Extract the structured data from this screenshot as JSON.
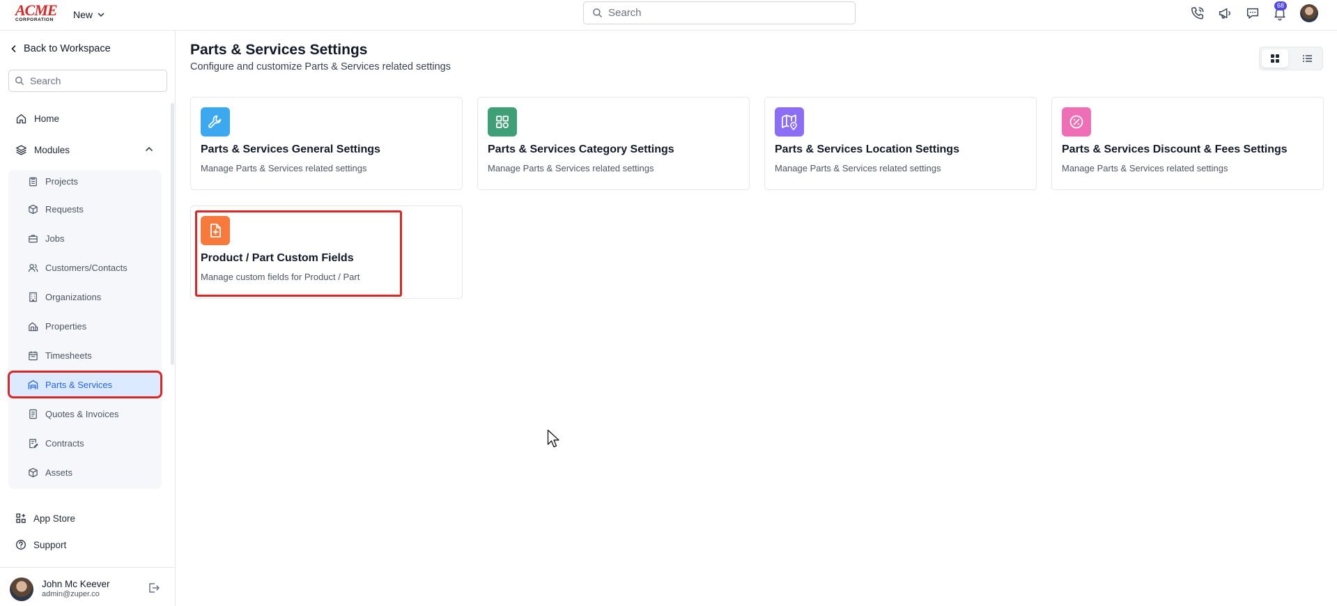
{
  "brand": {
    "logo_main": "ACME",
    "logo_sub": "CORPORATION"
  },
  "topbar": {
    "new_label": "New",
    "search_placeholder": "Search",
    "notification_count": "68",
    "icons": [
      "phone-icon",
      "megaphone-icon",
      "chat-icon",
      "bell-icon"
    ]
  },
  "sidebar": {
    "back_label": "Back to Workspace",
    "search_placeholder": "Search",
    "home_label": "Home",
    "modules_label": "Modules",
    "modules": [
      {
        "label": "Projects",
        "icon": "clipboard-icon"
      },
      {
        "label": "Requests",
        "icon": "box-icon"
      },
      {
        "label": "Jobs",
        "icon": "briefcase-icon"
      },
      {
        "label": "Customers/Contacts",
        "icon": "users-icon"
      },
      {
        "label": "Organizations",
        "icon": "building-icon"
      },
      {
        "label": "Properties",
        "icon": "property-icon"
      },
      {
        "label": "Timesheets",
        "icon": "calendar-icon"
      },
      {
        "label": "Parts & Services",
        "icon": "warehouse-icon",
        "active": true
      },
      {
        "label": "Quotes & Invoices",
        "icon": "invoice-icon"
      },
      {
        "label": "Contracts",
        "icon": "contract-icon"
      },
      {
        "label": "Assets",
        "icon": "cube-icon"
      }
    ],
    "app_store_label": "App Store",
    "support_label": "Support",
    "user": {
      "name": "John Mc Keever",
      "email": "admin@zuper.co"
    }
  },
  "main": {
    "title": "Parts & Services Settings",
    "subtitle": "Configure and customize Parts & Services related settings",
    "cards": [
      {
        "title": "Parts & Services General Settings",
        "description": "Manage Parts & Services related settings",
        "icon": "wrench-icon",
        "color": "#3ba8f0"
      },
      {
        "title": "Parts & Services Category Settings",
        "description": "Manage Parts & Services related settings",
        "icon": "grid-icon",
        "color": "#3f9f76"
      },
      {
        "title": "Parts & Services Location Settings",
        "description": "Manage Parts & Services related settings",
        "icon": "map-pin-icon",
        "color": "#8b6ef5"
      },
      {
        "title": "Parts & Services Discount & Fees Settings",
        "description": "Manage Parts & Services related settings",
        "icon": "percent-icon",
        "color": "#ef6fb6"
      },
      {
        "title": "Product / Part Custom Fields",
        "description": "Manage custom fields for Product / Part",
        "icon": "file-plus-icon",
        "color": "#f77a3c"
      }
    ]
  }
}
